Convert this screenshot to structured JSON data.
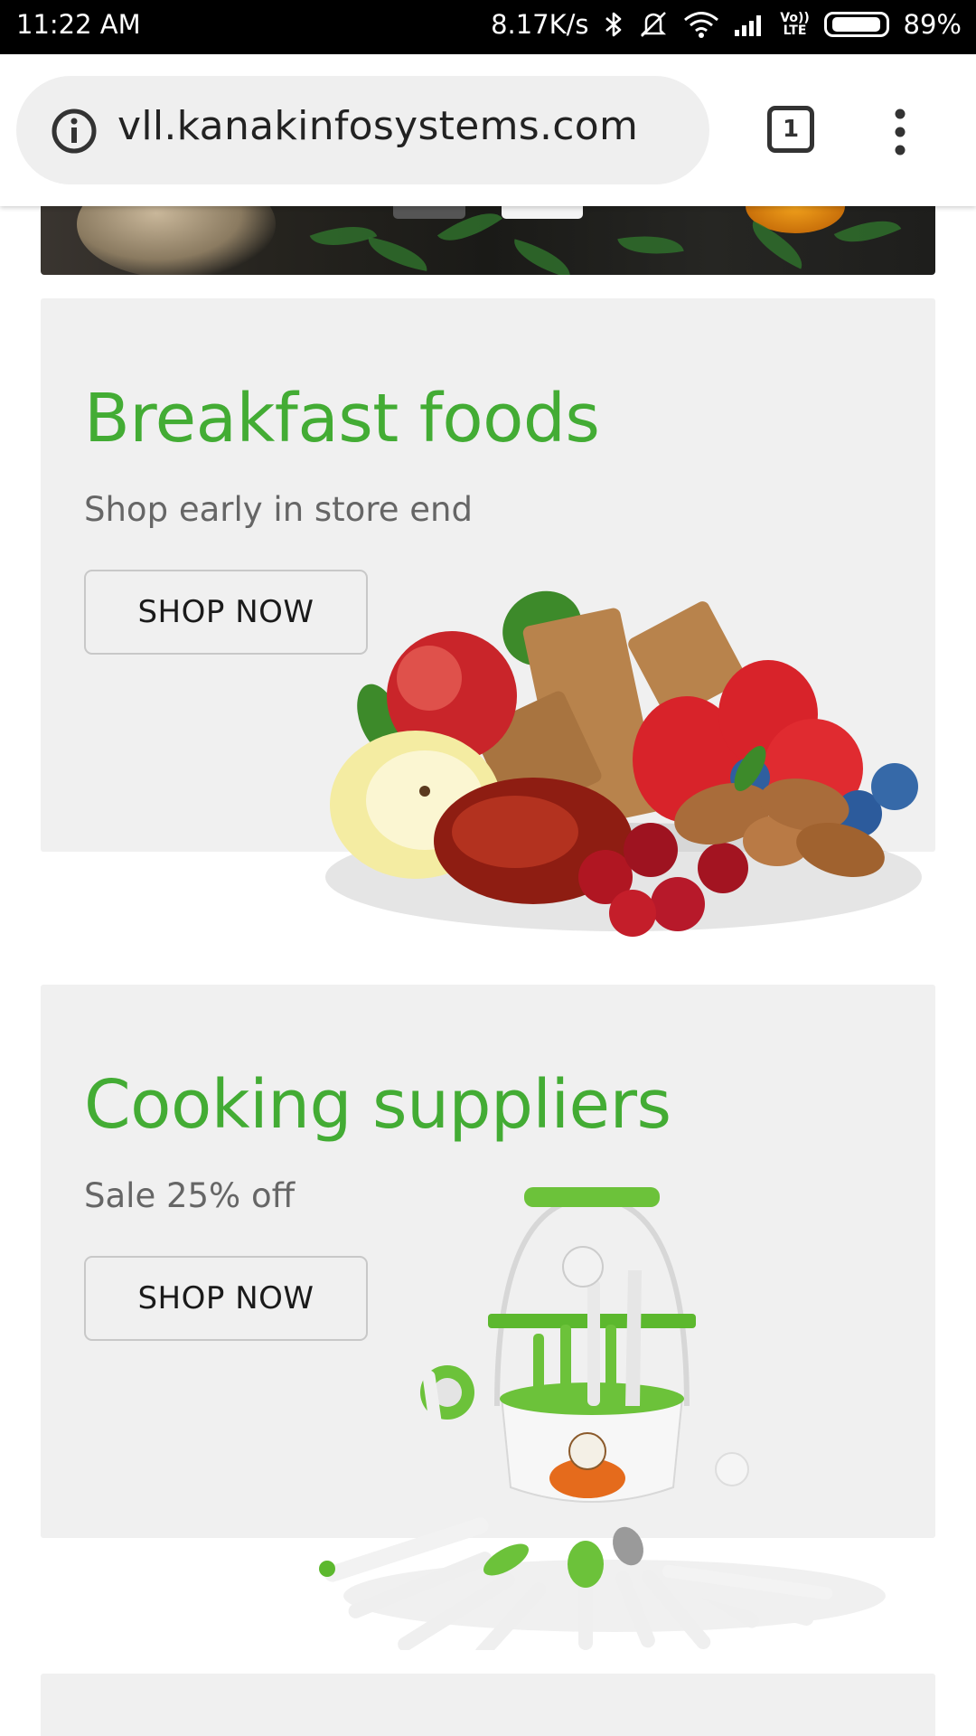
{
  "status_bar": {
    "time": "11:22 AM",
    "network_speed": "8.17K/s",
    "volte": "Vo)) LTE",
    "battery": "89%",
    "battery_level": 0.89,
    "icons": [
      "bluetooth-icon",
      "mute-icon",
      "wifi-icon",
      "signal-icon",
      "battery-icon"
    ]
  },
  "browser": {
    "url": "vll.kanakinfosystems.com",
    "tab_count": "1",
    "icons": [
      "info-icon",
      "tabs-icon",
      "overflow-menu-icon"
    ]
  },
  "promos": [
    {
      "title": "Breakfast foods",
      "subtitle": "Shop early in store end",
      "button_label": "SHOP NOW",
      "image": "breakfast-fruits-image"
    },
    {
      "title": "Cooking suppliers",
      "subtitle": "Sale 25% off",
      "button_label": "SHOP NOW",
      "image": "kitchen-utensil-set-image"
    }
  ],
  "colors": {
    "accent_green": "#43ac34",
    "card_background": "#f0f0f0",
    "status_bar": "#000000"
  }
}
